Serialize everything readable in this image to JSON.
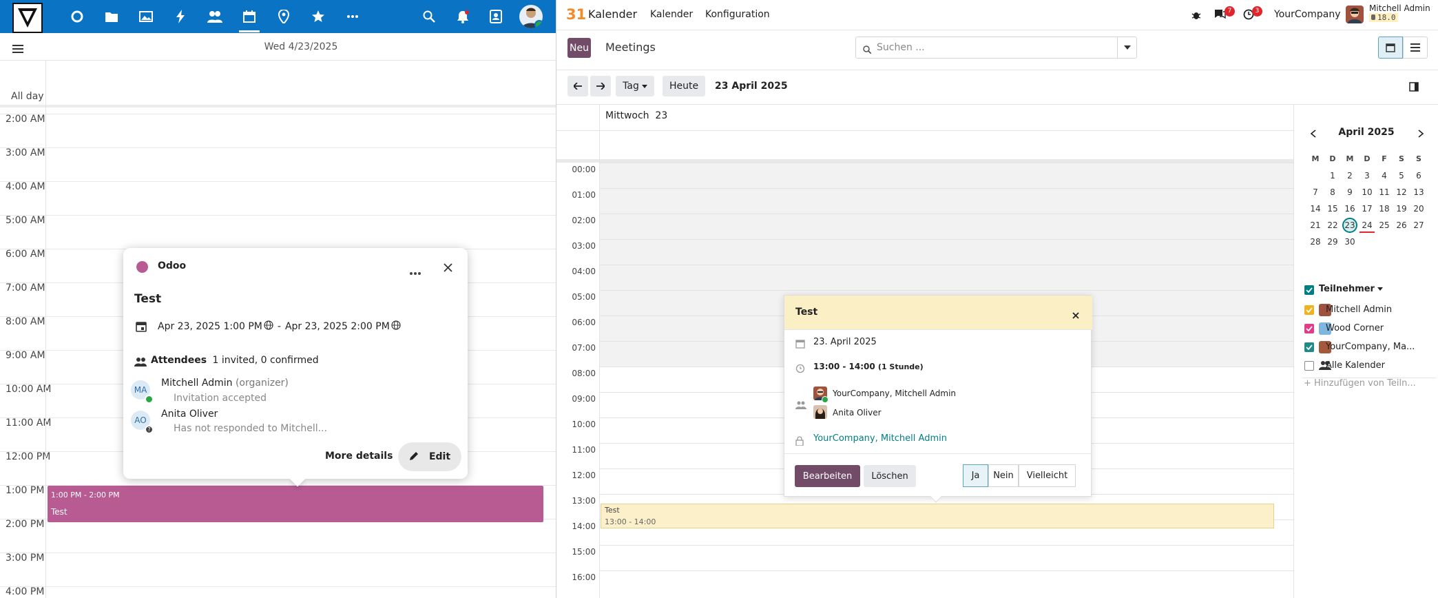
{
  "left": {
    "date_header": "Wed 4/23/2025",
    "all_day": "All day",
    "hours": [
      "2:00 AM",
      "3:00 AM",
      "4:00 AM",
      "5:00 AM",
      "6:00 AM",
      "7:00 AM",
      "8:00 AM",
      "9:00 AM",
      "10:00 AM",
      "11:00 AM",
      "12:00 PM",
      "1:00 PM",
      "2:00 PM",
      "3:00 PM",
      "4:00 PM"
    ],
    "event": {
      "time": "1:00 PM - 2:00 PM",
      "title": "Test",
      "color": "#b85b92"
    },
    "popup": {
      "calendar": "Odoo",
      "title": "Test",
      "start": "Apr 23, 2025 1:00 PM",
      "separator": "-",
      "end": "Apr 23, 2025 2:00 PM",
      "attendees_label": "Attendees",
      "attendees_summary": "1 invited, 0 confirmed",
      "attendees": [
        {
          "initials": "MA",
          "name": "Mitchell Admin",
          "role": "(organizer)",
          "status": "Invitation accepted"
        },
        {
          "initials": "AO",
          "name": "Anita Oliver",
          "role": "",
          "status": "Has not responded to Mitchell..."
        }
      ],
      "more_details": "More details",
      "edit": "Edit"
    }
  },
  "right": {
    "app_name": "Kalender",
    "menu": [
      "Kalender",
      "Konfiguration"
    ],
    "company": "YourCompany",
    "user": "Mitchell Admin",
    "version": "18.0",
    "badge_messages": "7",
    "badge_activities": "3",
    "new_button": "Neu",
    "view_title": "Meetings",
    "search_placeholder": "Suchen ...",
    "scale": "Tag",
    "today": "Heute",
    "current_date": "23 April 2025",
    "day_header": "Mittwoch  23",
    "hours": [
      "00:00",
      "01:00",
      "02:00",
      "03:00",
      "04:00",
      "05:00",
      "06:00",
      "07:00",
      "08:00",
      "09:00",
      "10:00",
      "11:00",
      "12:00",
      "13:00",
      "14:00",
      "15:00",
      "16:00"
    ],
    "event": {
      "title": "Test",
      "time": "13:00 - 14:00",
      "color": "#fbf0c9"
    },
    "popup": {
      "title": "Test",
      "date": "23. April 2025",
      "time": "13:00 - 14:00",
      "duration": "(1 Stunde)",
      "attendees": [
        "YourCompany, Mitchell Admin",
        "Anita Oliver"
      ],
      "organizer": "YourCompany, Mitchell Admin",
      "edit": "Bearbeiten",
      "delete": "Löschen",
      "rsvp": [
        "Ja",
        "Nein",
        "Vielleicht"
      ]
    },
    "mini_calendar": {
      "month": "April 2025",
      "weekdays": [
        "M",
        "D",
        "M",
        "D",
        "F",
        "S",
        "S"
      ],
      "weeks": [
        [
          "",
          "1",
          "2",
          "3",
          "4",
          "5",
          "6"
        ],
        [
          "7",
          "8",
          "9",
          "10",
          "11",
          "12",
          "13"
        ],
        [
          "14",
          "15",
          "16",
          "17",
          "18",
          "19",
          "20"
        ],
        [
          "21",
          "22",
          "23",
          "24",
          "25",
          "26",
          "27"
        ],
        [
          "28",
          "29",
          "30",
          "",
          "",
          "",
          ""
        ]
      ],
      "selected": "23"
    },
    "filters": {
      "title": "Teilnehmer",
      "items": [
        {
          "label": "Mitchell Admin",
          "checked": true,
          "color": "#f0b31f"
        },
        {
          "label": "Wood Corner",
          "checked": true,
          "color": "#e03c8a"
        },
        {
          "label": "YourCompany, Ma...",
          "checked": true,
          "color": "#1e8a8a"
        },
        {
          "label": "Alle Kalender",
          "checked": false,
          "color": "#ffffff"
        }
      ],
      "add": "+ Hinzufügen von Teiln..."
    }
  }
}
